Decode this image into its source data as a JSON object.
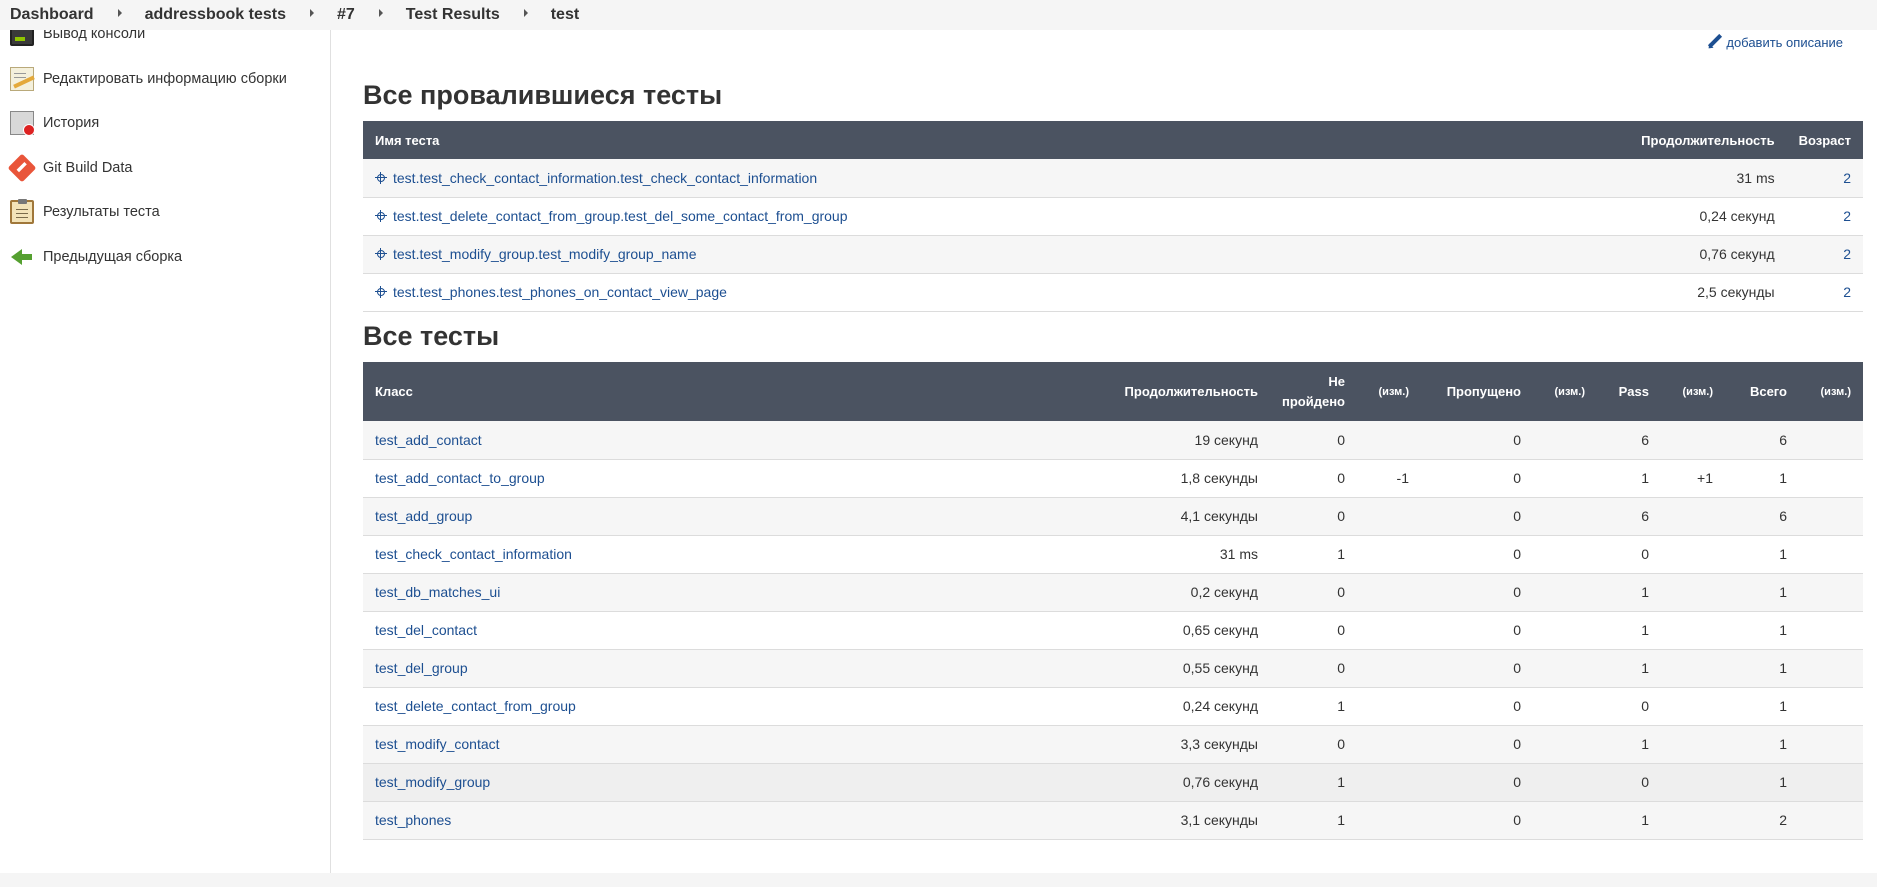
{
  "breadcrumb": [
    "Dashboard",
    "addressbook tests",
    "#7",
    "Test Results",
    "test"
  ],
  "sidebar": {
    "items": [
      {
        "label": "Вывод консоли",
        "icon": "console-icon"
      },
      {
        "label": "Редактировать информацию сборки",
        "icon": "edit-notepad-icon"
      },
      {
        "label": "История",
        "icon": "history-icon"
      },
      {
        "label": "Git Build Data",
        "icon": "git-icon"
      },
      {
        "label": "Результаты теста",
        "icon": "clipboard-icon"
      },
      {
        "label": "Предыдущая сборка",
        "icon": "left-arrow-icon"
      }
    ]
  },
  "main": {
    "add_description": "добавить описание",
    "failed_title": "Все провалившиеся тесты",
    "failed_headers": {
      "name": "Имя теста",
      "duration": "Продолжительность",
      "age": "Возраст"
    },
    "failed_rows": [
      {
        "name": "test.test_check_contact_information.test_check_contact_information",
        "duration": "31 ms",
        "age": "2"
      },
      {
        "name": "test.test_delete_contact_from_group.test_del_some_contact_from_group",
        "duration": "0,24 секунд",
        "age": "2"
      },
      {
        "name": "test.test_modify_group.test_modify_group_name",
        "duration": "0,76 секунд",
        "age": "2"
      },
      {
        "name": "test.test_phones.test_phones_on_contact_view_page",
        "duration": "2,5 секунды",
        "age": "2"
      }
    ],
    "all_title": "Все тесты",
    "all_headers": {
      "cls": "Класс",
      "duration": "Продолжительность",
      "failed_1": "Не",
      "failed_2": "пройдено",
      "diff": "(изм.)",
      "skipped": "Пропущено",
      "pass": "Pass",
      "total": "Всего"
    },
    "all_rows": [
      {
        "cls": "test_add_contact",
        "duration": "19 секунд",
        "failed": "0",
        "failed_diff": "",
        "skipped": "0",
        "skipped_diff": "",
        "pass": "6",
        "pass_diff": "",
        "total": "6",
        "total_diff": ""
      },
      {
        "cls": "test_add_contact_to_group",
        "duration": "1,8 секунды",
        "failed": "0",
        "failed_diff": "-1",
        "skipped": "0",
        "skipped_diff": "",
        "pass": "1",
        "pass_diff": "+1",
        "total": "1",
        "total_diff": ""
      },
      {
        "cls": "test_add_group",
        "duration": "4,1 секунды",
        "failed": "0",
        "failed_diff": "",
        "skipped": "0",
        "skipped_diff": "",
        "pass": "6",
        "pass_diff": "",
        "total": "6",
        "total_diff": ""
      },
      {
        "cls": "test_check_contact_information",
        "duration": "31 ms",
        "failed": "1",
        "failed_diff": "",
        "skipped": "0",
        "skipped_diff": "",
        "pass": "0",
        "pass_diff": "",
        "total": "1",
        "total_diff": ""
      },
      {
        "cls": "test_db_matches_ui",
        "duration": "0,2 секунд",
        "failed": "0",
        "failed_diff": "",
        "skipped": "0",
        "skipped_diff": "",
        "pass": "1",
        "pass_diff": "",
        "total": "1",
        "total_diff": ""
      },
      {
        "cls": "test_del_contact",
        "duration": "0,65 секунд",
        "failed": "0",
        "failed_diff": "",
        "skipped": "0",
        "skipped_diff": "",
        "pass": "1",
        "pass_diff": "",
        "total": "1",
        "total_diff": ""
      },
      {
        "cls": "test_del_group",
        "duration": "0,55 секунд",
        "failed": "0",
        "failed_diff": "",
        "skipped": "0",
        "skipped_diff": "",
        "pass": "1",
        "pass_diff": "",
        "total": "1",
        "total_diff": ""
      },
      {
        "cls": "test_delete_contact_from_group",
        "duration": "0,24 секунд",
        "failed": "1",
        "failed_diff": "",
        "skipped": "0",
        "skipped_diff": "",
        "pass": "0",
        "pass_diff": "",
        "total": "1",
        "total_diff": ""
      },
      {
        "cls": "test_modify_contact",
        "duration": "3,3 секунды",
        "failed": "0",
        "failed_diff": "",
        "skipped": "0",
        "skipped_diff": "",
        "pass": "1",
        "pass_diff": "",
        "total": "1",
        "total_diff": ""
      },
      {
        "cls": "test_modify_group",
        "duration": "0,76 секунд",
        "failed": "1",
        "failed_diff": "",
        "skipped": "0",
        "skipped_diff": "",
        "pass": "0",
        "pass_diff": "",
        "total": "1",
        "total_diff": ""
      },
      {
        "cls": "test_phones",
        "duration": "3,1 секунды",
        "failed": "1",
        "failed_diff": "",
        "skipped": "0",
        "skipped_diff": "",
        "pass": "1",
        "pass_diff": "",
        "total": "2",
        "total_diff": ""
      }
    ]
  },
  "colors": {
    "header_bg": "#4b5361",
    "link": "#1d4f91",
    "breadcrumb_bg": "#f5f5f5"
  }
}
